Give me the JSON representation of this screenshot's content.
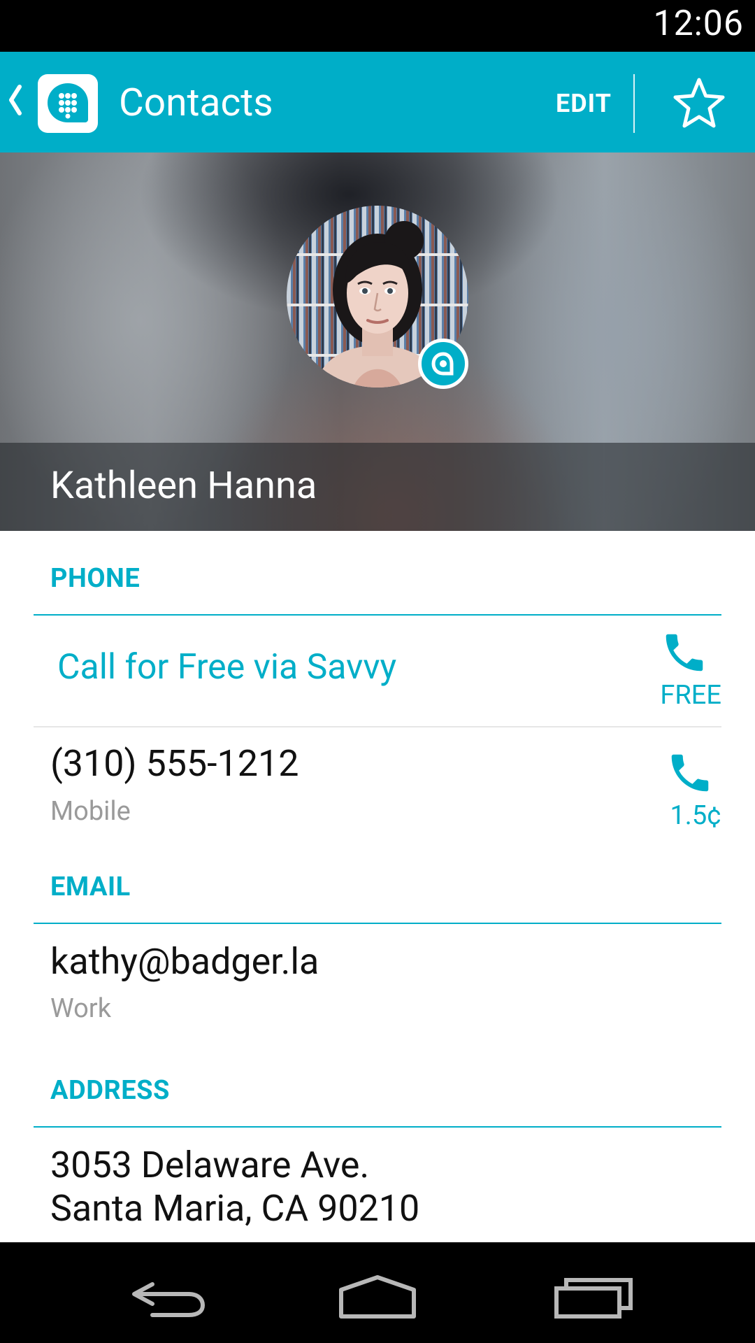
{
  "status_bar": {
    "time": "12:06"
  },
  "app_bar": {
    "title": "Contacts",
    "edit_label": "EDIT",
    "icons": {
      "back": "chevron-left-icon",
      "logo": "savvy-dialpad-logo-icon",
      "star": "star-outline-icon"
    },
    "color": "#00aec8"
  },
  "contact": {
    "name": "Kathleen Hanna",
    "avatar": "contact-photo",
    "badge_icon": "savvy-badge-icon"
  },
  "phone": {
    "header": "PHONE",
    "free_call": {
      "label": "Call for Free via Savvy",
      "rate": "FREE",
      "icon": "phone-icon"
    },
    "entries": [
      {
        "number": "(310) 555-1212",
        "type": "Mobile",
        "rate": "1.5¢",
        "icon": "phone-icon"
      }
    ]
  },
  "email": {
    "header": "EMAIL",
    "entries": [
      {
        "address": "kathy@badger.la",
        "type": "Work"
      }
    ]
  },
  "address": {
    "header": "ADDRESS",
    "line1": "3053 Delaware Ave.",
    "line2": "Santa Maria, CA 90210"
  },
  "nav_bar": {
    "icons": [
      "back-icon",
      "home-icon",
      "recents-icon"
    ]
  },
  "colors": {
    "accent": "#00aec8",
    "primary_text": "#111111",
    "secondary_text": "#9a9a9a"
  }
}
